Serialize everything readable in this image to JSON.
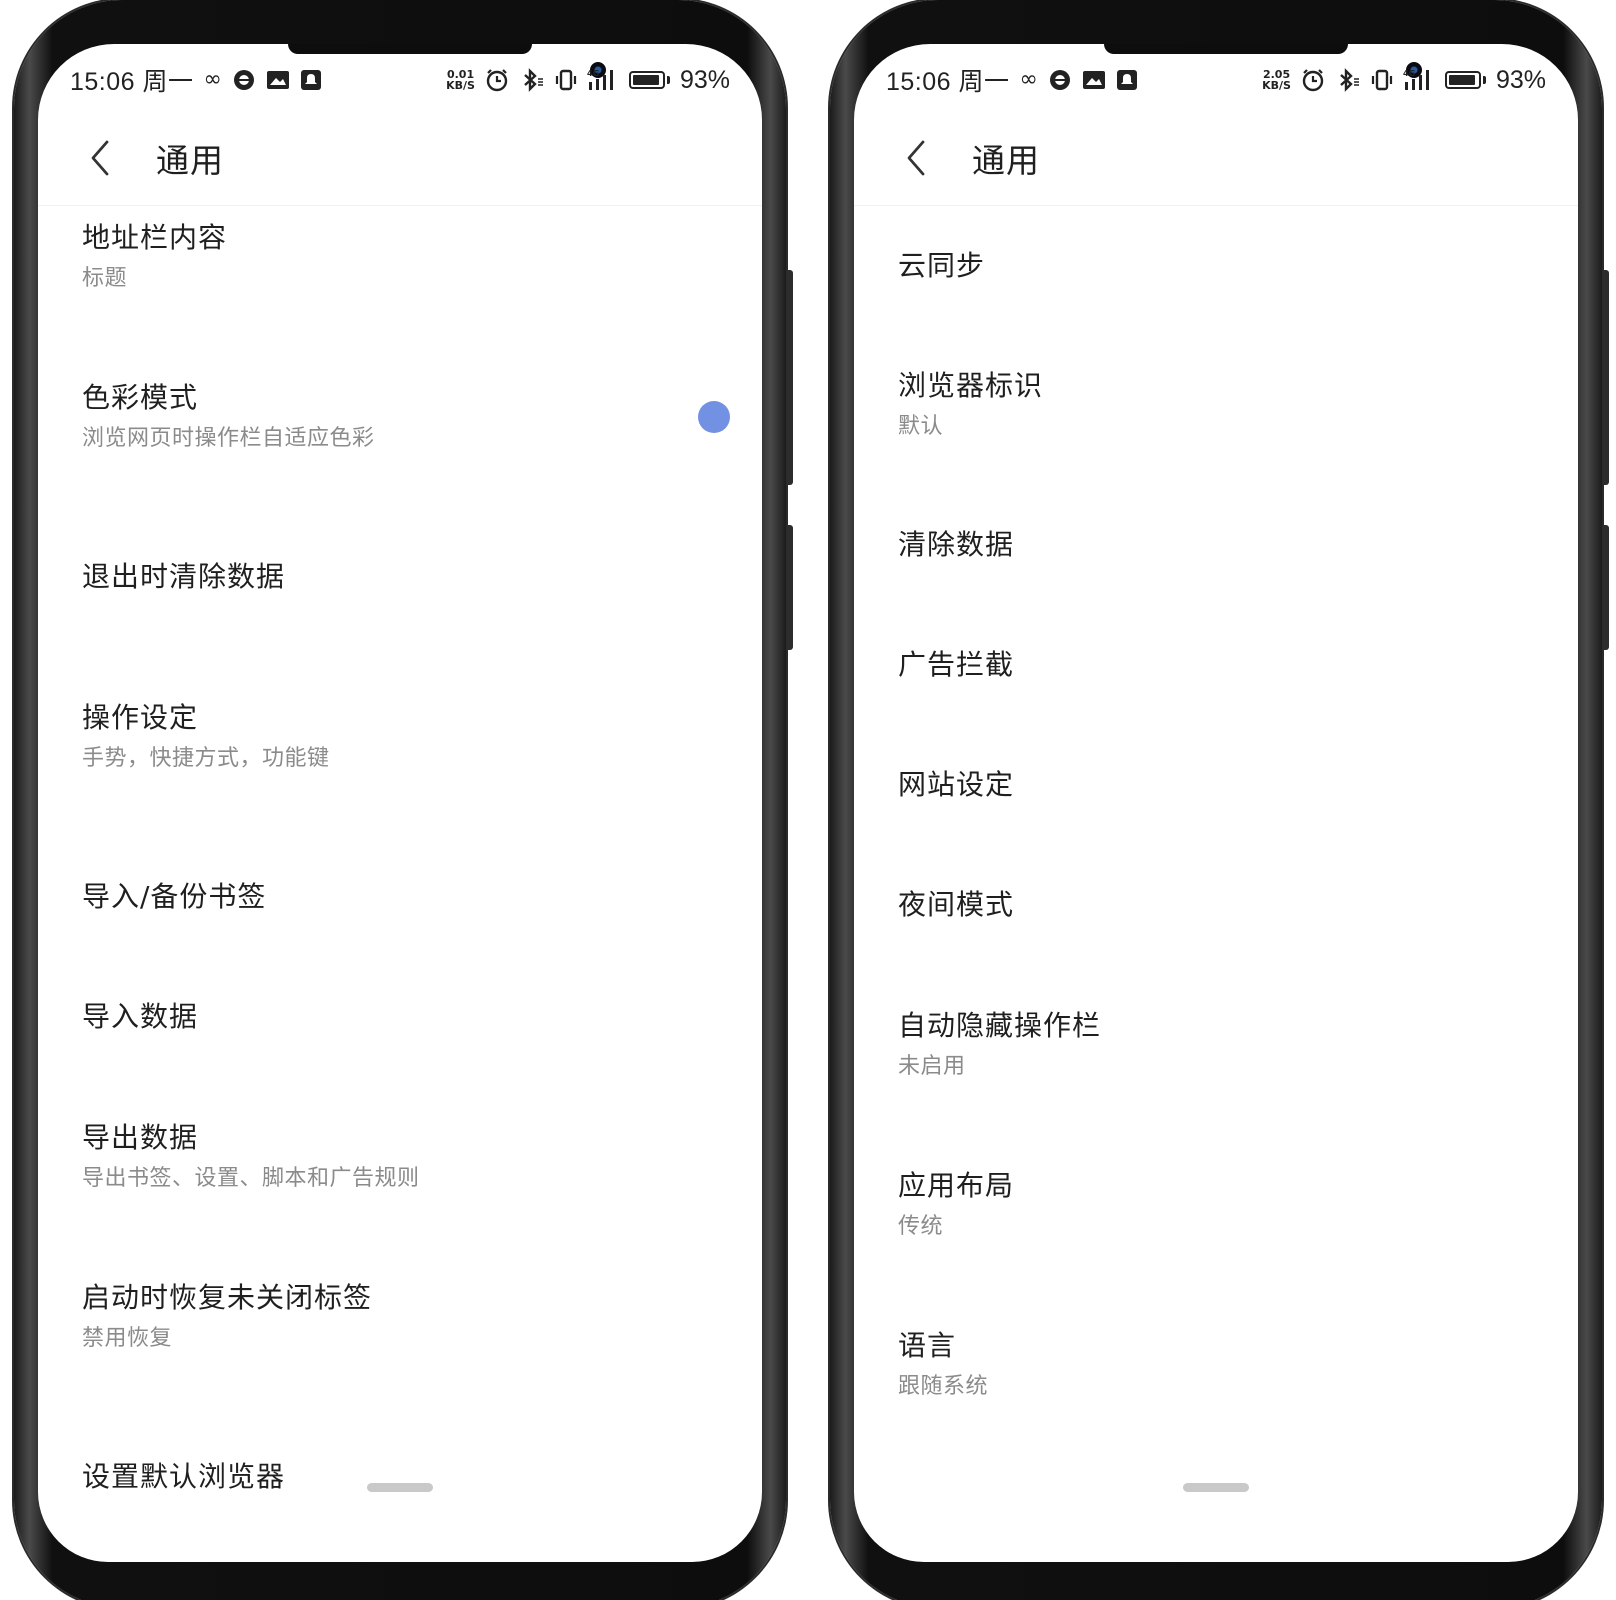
{
  "colors": {
    "accent": "#7391e3",
    "text_primary": "#1f1f1f",
    "text_secondary": "#8b8b8b"
  },
  "phones": [
    {
      "status": {
        "time": "15:06 周一",
        "netspeed_value": "0.01",
        "netspeed_unit": "KB/S",
        "network": "4G",
        "battery": "93%",
        "battery_level": 0.93
      },
      "appbar": {
        "title": "通用"
      },
      "items": [
        {
          "title": "地址栏内容",
          "subtitle": "标题"
        },
        {
          "title": "色彩模式",
          "subtitle": "浏览网页时操作栏自适应色彩",
          "toggle": true
        },
        {
          "title": "退出时清除数据"
        },
        {
          "title": "操作设定",
          "subtitle": "手势，快捷方式，功能键"
        },
        {
          "title": "导入/备份书签"
        },
        {
          "title": "导入数据"
        },
        {
          "title": "导出数据",
          "subtitle": "导出书签、设置、脚本和广告规则"
        },
        {
          "title": "启动时恢复未关闭标签",
          "subtitle": "禁用恢复"
        },
        {
          "title": "设置默认浏览器"
        }
      ]
    },
    {
      "status": {
        "time": "15:06 周一",
        "netspeed_value": "2.05",
        "netspeed_unit": "KB/S",
        "network": "4G",
        "battery": "93%",
        "battery_level": 0.93
      },
      "appbar": {
        "title": "通用"
      },
      "items": [
        {
          "title": "云同步"
        },
        {
          "title": "浏览器标识",
          "subtitle": "默认"
        },
        {
          "title": "清除数据"
        },
        {
          "title": "广告拦截"
        },
        {
          "title": "网站设定"
        },
        {
          "title": "夜间模式"
        },
        {
          "title": "自动隐藏操作栏",
          "subtitle": "未启用"
        },
        {
          "title": "应用布局",
          "subtitle": "传统"
        },
        {
          "title": "语言",
          "subtitle": "跟随系统"
        }
      ]
    }
  ]
}
